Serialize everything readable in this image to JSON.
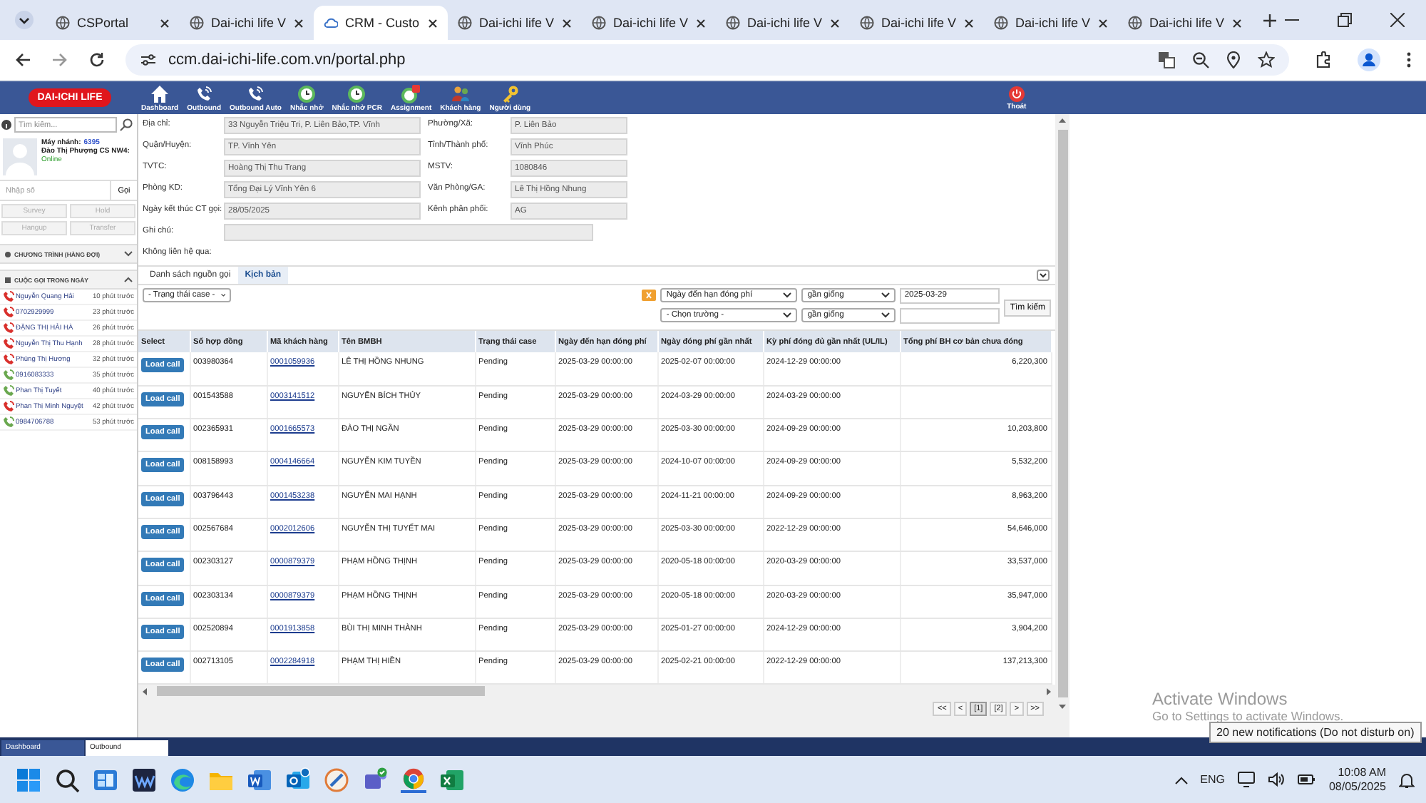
{
  "browser": {
    "tabs": [
      {
        "title": "CSPortal",
        "selected": false,
        "kind": "globe"
      },
      {
        "title": "Dai-ichi life V",
        "selected": false,
        "kind": "globe"
      },
      {
        "title": "CRM - Custo",
        "selected": true,
        "kind": "cloud"
      },
      {
        "title": "Dai-ichi life V",
        "selected": false,
        "kind": "globe"
      },
      {
        "title": "Dai-ichi life V",
        "selected": false,
        "kind": "globe"
      },
      {
        "title": "Dai-ichi life V",
        "selected": false,
        "kind": "globe"
      },
      {
        "title": "Dai-ichi life V",
        "selected": false,
        "kind": "globe"
      },
      {
        "title": "Dai-ichi life V",
        "selected": false,
        "kind": "globe"
      },
      {
        "title": "Dai-ichi life V",
        "selected": false,
        "kind": "globe"
      }
    ],
    "url": "ccm.dai-ichi-life.com.vn/portal.php"
  },
  "app": {
    "logo": "DAI-ICHI LIFE",
    "nav": [
      {
        "label": "Dashboard",
        "kind": "home"
      },
      {
        "label": "Outbound",
        "kind": "phone"
      },
      {
        "label": "Outbound Auto",
        "kind": "phone"
      },
      {
        "label": "Nhắc nhở",
        "kind": "clock"
      },
      {
        "label": "Nhắc nhở PCR",
        "kind": "clock"
      },
      {
        "label": "Assignment",
        "kind": "alert"
      },
      {
        "label": "Khách hàng",
        "kind": "people"
      },
      {
        "label": "Người dùng",
        "kind": "key"
      }
    ],
    "logout": "Thoát"
  },
  "sidebar": {
    "search_placeholder": "Tìm kiếm...",
    "extension_label": "Máy nhánh:",
    "extension": "6395",
    "agent": "Đào Thị Phượng CS NW4:",
    "status": "Online",
    "dial_placeholder": "Nhập số",
    "call_button": "Gọi",
    "call_controls": [
      {
        "label": "Survey",
        "disabled": true
      },
      {
        "label": "Hold",
        "disabled": true
      },
      {
        "label": "Hangup",
        "disabled": true
      },
      {
        "label": "Transfer",
        "disabled": true
      }
    ],
    "sections": [
      {
        "title": "CHƯƠNG TRÌNH (HÀNG ĐỢI)",
        "expanded": false
      },
      {
        "title": "CUỘC GỌI TRONG NGÀY",
        "expanded": true
      }
    ],
    "calls": [
      {
        "name": "Nguyễn Quang Hải",
        "time": "10 phút trước",
        "color": "#d9302c"
      },
      {
        "name": "0702929999",
        "time": "23 phút trước",
        "color": "#d9302c"
      },
      {
        "name": "ĐẶNG THỊ HẢI HÀ",
        "time": "26 phút trước",
        "color": "#d9302c"
      },
      {
        "name": "Nguyễn Thị Thu Hạnh",
        "time": "28 phút trước",
        "color": "#d9302c"
      },
      {
        "name": "Phùng Thị Hương",
        "time": "32 phút trước",
        "color": "#d9302c"
      },
      {
        "name": "0916083333",
        "time": "35 phút trước",
        "color": "#6aa84f"
      },
      {
        "name": "Phan Thị Tuyết",
        "time": "40 phút trước",
        "color": "#6aa84f"
      },
      {
        "name": "Phan Thị Minh Nguyệt",
        "time": "42 phút trước",
        "color": "#d9302c"
      },
      {
        "name": "0984706788",
        "time": "53 phút trước",
        "color": "#6aa84f"
      }
    ]
  },
  "form": {
    "rows": [
      {
        "left": {
          "label": "Địa chỉ:",
          "value": "33 Nguyễn Triệu Tri, P. Liên Bảo,TP. Vĩnh",
          "kind": "input"
        },
        "right": {
          "label": "Phường/Xã:",
          "value": "P. Liên Bảo",
          "kind": "input"
        }
      },
      {
        "left": {
          "label": "Quận/Huyện:",
          "value": "TP. Vĩnh Yên",
          "kind": "input"
        },
        "right": {
          "label": "Tỉnh/Thành phố:",
          "value": "Vĩnh Phúc",
          "kind": "input"
        }
      },
      {
        "left": {
          "label": "TVTC:",
          "value": "Hoàng Thị Thu Trang",
          "kind": "input"
        },
        "right": {
          "label": "MSTV:",
          "value": "1080846",
          "kind": "input"
        }
      },
      {
        "left": {
          "label": "Phòng KD:",
          "value": "Tổng Đại Lý Vĩnh Yên 6",
          "kind": "input"
        },
        "right": {
          "label": "Văn Phòng/GA:",
          "value": "Lê Thị Hồng Nhung",
          "kind": "input"
        }
      },
      {
        "left": {
          "label": "Ngày kết thúc CT gọi:",
          "value": "28/05/2025",
          "kind": "input"
        },
        "right": {
          "label": "Kênh phân phối:",
          "value": "AG",
          "kind": "input"
        }
      },
      {
        "left": {
          "label": "Ghi chú:",
          "kind": "note"
        }
      },
      {
        "left": {
          "label": "Không liên hệ qua:",
          "kind": "label"
        }
      }
    ]
  },
  "tabs": [
    {
      "label": "Danh sách nguồn gọi",
      "selected": false
    },
    {
      "label": "Kịch bản",
      "selected": true
    }
  ],
  "filters": {
    "status_select": "- Trạng thái case -",
    "conditions": [
      {
        "field": "Ngày đến hạn đóng phí",
        "operator": "gần giống",
        "value": "2025-03-29"
      },
      {
        "field": "- Chọn trường -",
        "operator": "gần giống"
      }
    ],
    "search_button": "Tìm kiếm"
  },
  "table": {
    "columns": [
      "Select",
      "Số hợp đồng",
      "Mã khách hàng",
      "Tên BMBH",
      "Trạng thái case",
      "Ngày đến hạn đóng phí",
      "Ngày đóng phí gần nhất",
      "Kỳ phí đóng đủ gần nhất (UL/IL)",
      "Tổng phí BH cơ bản chưa đóng"
    ],
    "rows": [
      {
        "action": "Load call",
        "contract": "003980364",
        "customer_id": "0001059936",
        "name": "LÊ THỊ HỒNG NHUNG",
        "status": "Pending",
        "due_date": "2025-03-29 00:00:00",
        "last_paid": "2025-02-07 00:00:00",
        "period": "2024-12-29 00:00:00",
        "total": "6,220,300"
      },
      {
        "action": "Load call",
        "contract": "001543588",
        "customer_id": "0003141512",
        "name": "NGUYỄN BÍCH THỦY",
        "status": "Pending",
        "due_date": "2025-03-29 00:00:00",
        "last_paid": "2024-03-29 00:00:00",
        "period": "2024-03-29 00:00:00"
      },
      {
        "action": "Load call",
        "contract": "002365931",
        "customer_id": "0001665573",
        "name": "ĐÀO THỊ NGẦN",
        "status": "Pending",
        "due_date": "2025-03-29 00:00:00",
        "last_paid": "2025-03-30 00:00:00",
        "period": "2024-09-29 00:00:00",
        "total": "10,203,800"
      },
      {
        "action": "Load call",
        "contract": "008158993",
        "customer_id": "0004146664",
        "name": "NGUYỄN KIM TUYỀN",
        "status": "Pending",
        "due_date": "2025-03-29 00:00:00",
        "last_paid": "2024-10-07 00:00:00",
        "period": "2024-09-29 00:00:00",
        "total": "5,532,200"
      },
      {
        "action": "Load call",
        "contract": "003796443",
        "customer_id": "0001453238",
        "name": "NGUYỄN MAI HẠNH",
        "status": "Pending",
        "due_date": "2025-03-29 00:00:00",
        "last_paid": "2024-11-21 00:00:00",
        "period": "2024-09-29 00:00:00",
        "total": "8,963,200"
      },
      {
        "action": "Load call",
        "contract": "002567684",
        "customer_id": "0002012606",
        "name": "NGUYỄN THỊ TUYẾT MAI",
        "status": "Pending",
        "due_date": "2025-03-29 00:00:00",
        "last_paid": "2025-03-30 00:00:00",
        "period": "2022-12-29 00:00:00",
        "total": "54,646,000"
      },
      {
        "action": "Load call",
        "contract": "002303127",
        "customer_id": "0000879379",
        "name": "PHẠM HỒNG THỊNH",
        "status": "Pending",
        "due_date": "2025-03-29 00:00:00",
        "last_paid": "2020-05-18 00:00:00",
        "period": "2020-03-29 00:00:00",
        "total": "33,537,000"
      },
      {
        "action": "Load call",
        "contract": "002303134",
        "customer_id": "0000879379",
        "name": "PHẠM HỒNG THỊNH",
        "status": "Pending",
        "due_date": "2025-03-29 00:00:00",
        "last_paid": "2020-05-18 00:00:00",
        "period": "2020-03-29 00:00:00",
        "total": "35,947,000"
      },
      {
        "action": "Load call",
        "contract": "002520894",
        "customer_id": "0001913858",
        "name": "BÙI THỊ MINH THÀNH",
        "status": "Pending",
        "due_date": "2025-03-29 00:00:00",
        "last_paid": "2025-01-27 00:00:00",
        "period": "2024-12-29 00:00:00",
        "total": "3,904,200"
      },
      {
        "action": "Load call",
        "contract": "002713105",
        "customer_id": "0002284918",
        "name": "PHẠM THỊ HIỀN",
        "status": "Pending",
        "due_date": "2025-03-29 00:00:00",
        "last_paid": "2025-02-21 00:00:00",
        "period": "2022-12-29 00:00:00",
        "total": "137,213,300"
      }
    ]
  },
  "pager": [
    {
      "label": "<<",
      "selected": false
    },
    {
      "label": "<",
      "selected": false
    },
    {
      "label": "[1]",
      "selected": true
    },
    {
      "label": "[2]",
      "selected": false
    },
    {
      "label": ">",
      "selected": false
    },
    {
      "label": ">>",
      "selected": false
    }
  ],
  "os_notice": {
    "title": "Activate Windows",
    "text": "Go to Settings to activate Windows."
  },
  "bottom_tabs": [
    {
      "label": "Dashboard",
      "selected": false
    },
    {
      "label": "Outbound",
      "selected": true
    }
  ],
  "notification": "20 new notifications (Do not disturb on)",
  "taskbar": {
    "language": "ENG",
    "time": "10:08 AM",
    "date": "08/05/2025"
  }
}
